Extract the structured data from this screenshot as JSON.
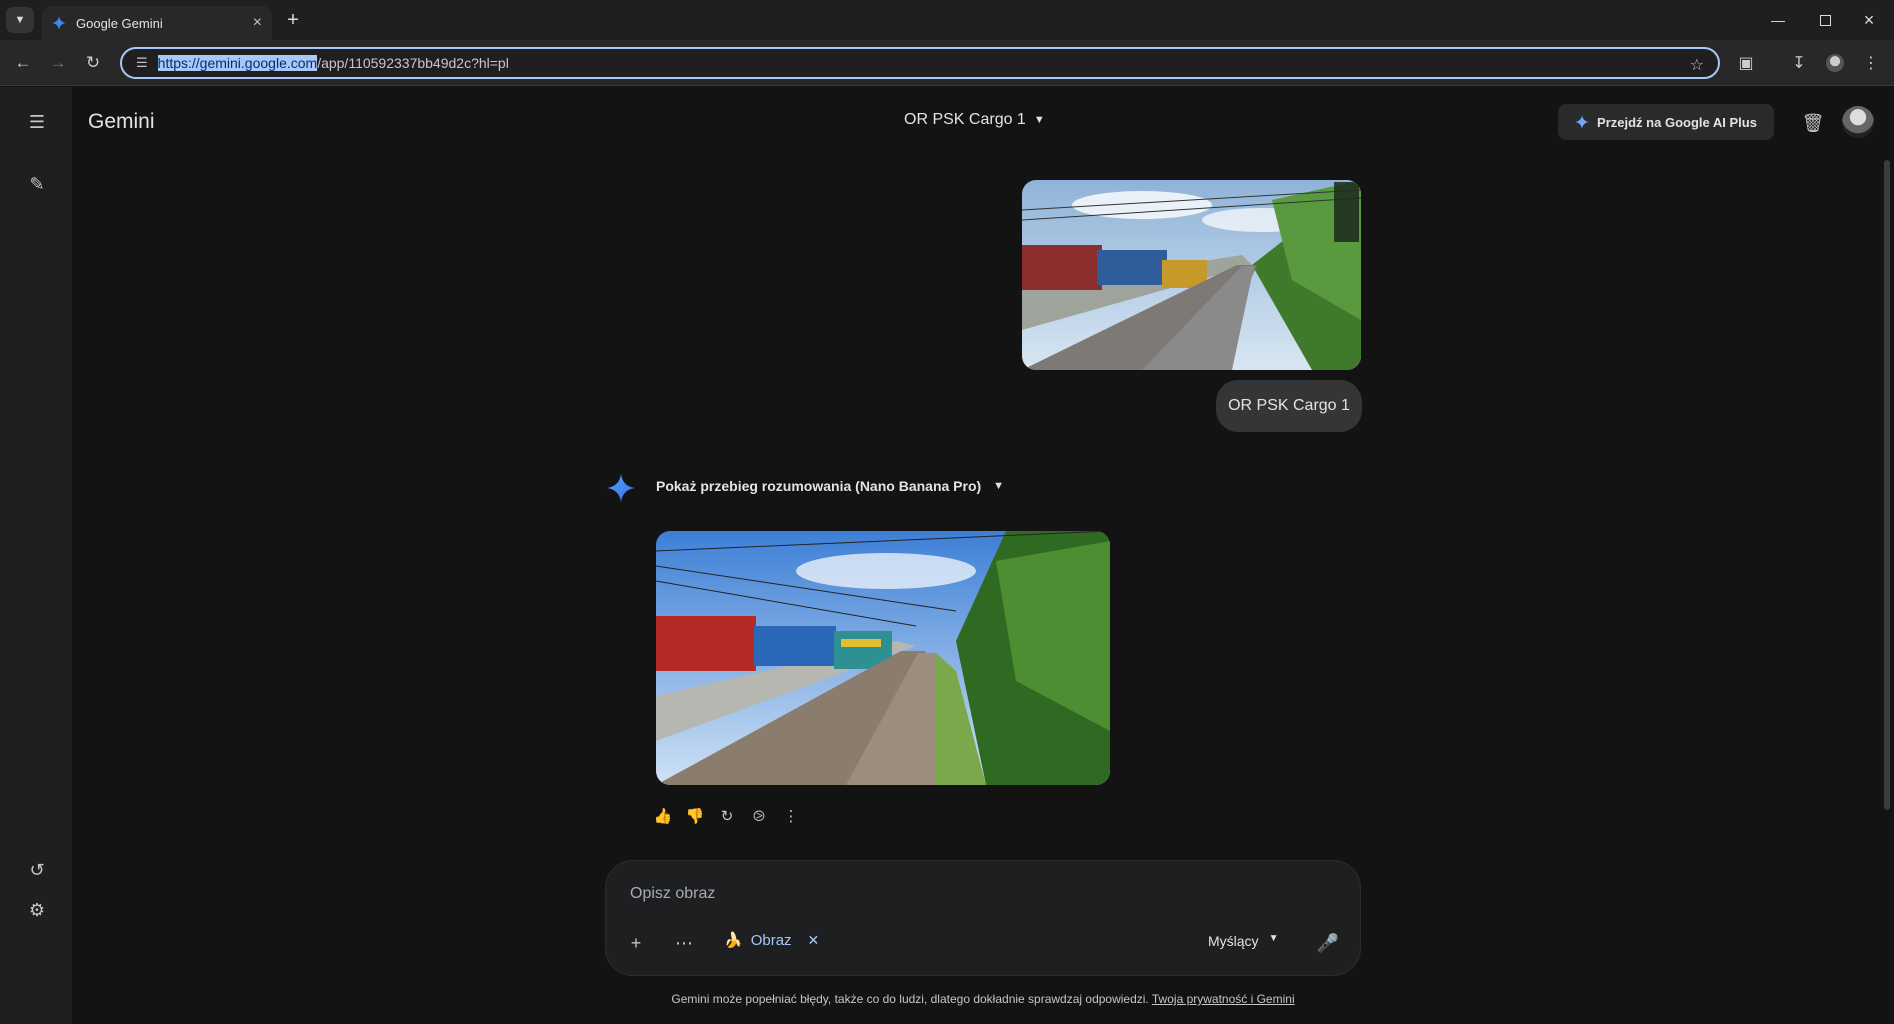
{
  "browser": {
    "tab_title": "Google Gemini",
    "url_selected": "https://gemini.google.com",
    "url_rest": "/app/110592337bb49d2c?hl=pl"
  },
  "app": {
    "title": "Gemini",
    "chat_title": "OR PSK Cargo 1",
    "upgrade_label": "Przejdź na Google AI Plus"
  },
  "chat": {
    "user_message": "OR PSK Cargo 1",
    "thought_label": "Pokaż przebieg rozumowania (Nano Banana Pro)"
  },
  "input": {
    "placeholder": "Opisz obraz",
    "chip_label": "Obraz",
    "mode_label": "Myślący"
  },
  "footer": {
    "disclaimer": "Gemini może popełniać błędy, także co do ludzi, dlatego dokładnie sprawdzaj odpowiedzi. ",
    "privacy_link": "Twoja prywatność i Gemini"
  },
  "colors": {
    "background": "#131314",
    "sidebar": "#1e1f20",
    "accent": "#a8c7fa",
    "spark_blue": "#4285f4"
  }
}
